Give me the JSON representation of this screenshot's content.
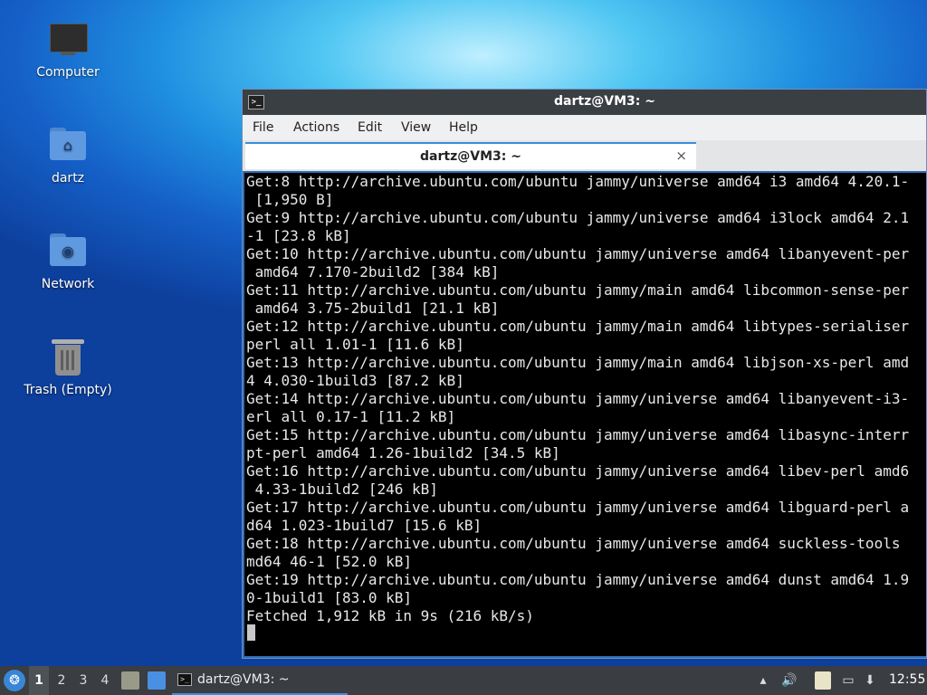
{
  "desktop": {
    "icons": [
      {
        "label": "Computer"
      },
      {
        "label": "dartz"
      },
      {
        "label": "Network"
      },
      {
        "label": "Trash (Empty)"
      }
    ]
  },
  "window": {
    "title": "dartz@VM3: ~",
    "menu": [
      "File",
      "Actions",
      "Edit",
      "View",
      "Help"
    ],
    "tab": {
      "label": "dartz@VM3: ~",
      "close_symbol": "×"
    },
    "terminal_lines": [
      "Get:8 http://archive.ubuntu.com/ubuntu jammy/universe amd64 i3 amd64 4.20.1-",
      " [1,950 B]",
      "Get:9 http://archive.ubuntu.com/ubuntu jammy/universe amd64 i3lock amd64 2.1",
      "-1 [23.8 kB]",
      "Get:10 http://archive.ubuntu.com/ubuntu jammy/universe amd64 libanyevent-per",
      " amd64 7.170-2build2 [384 kB]",
      "Get:11 http://archive.ubuntu.com/ubuntu jammy/main amd64 libcommon-sense-per",
      " amd64 3.75-2build1 [21.1 kB]",
      "Get:12 http://archive.ubuntu.com/ubuntu jammy/main amd64 libtypes-serialiser",
      "perl all 1.01-1 [11.6 kB]",
      "Get:13 http://archive.ubuntu.com/ubuntu jammy/main amd64 libjson-xs-perl amd",
      "4 4.030-1build3 [87.2 kB]",
      "Get:14 http://archive.ubuntu.com/ubuntu jammy/universe amd64 libanyevent-i3-",
      "erl all 0.17-1 [11.2 kB]",
      "Get:15 http://archive.ubuntu.com/ubuntu jammy/universe amd64 libasync-interr",
      "pt-perl amd64 1.26-1build2 [34.5 kB]",
      "Get:16 http://archive.ubuntu.com/ubuntu jammy/universe amd64 libev-perl amd6",
      " 4.33-1build2 [246 kB]",
      "Get:17 http://archive.ubuntu.com/ubuntu jammy/universe amd64 libguard-perl a",
      "d64 1.023-1build7 [15.6 kB]",
      "Get:18 http://archive.ubuntu.com/ubuntu jammy/universe amd64 suckless-tools",
      "md64 46-1 [52.0 kB]",
      "Get:19 http://archive.ubuntu.com/ubuntu jammy/universe amd64 dunst amd64 1.9",
      "0-1build1 [83.0 kB]",
      "Fetched 1,912 kB in 9s (216 kB/s)"
    ]
  },
  "taskbar": {
    "workspaces": [
      "1",
      "2",
      "3",
      "4"
    ],
    "active_workspace": "1",
    "task_label": "dartz@VM3: ~",
    "clock": "12:55",
    "accent_color": "#3b8edb"
  }
}
